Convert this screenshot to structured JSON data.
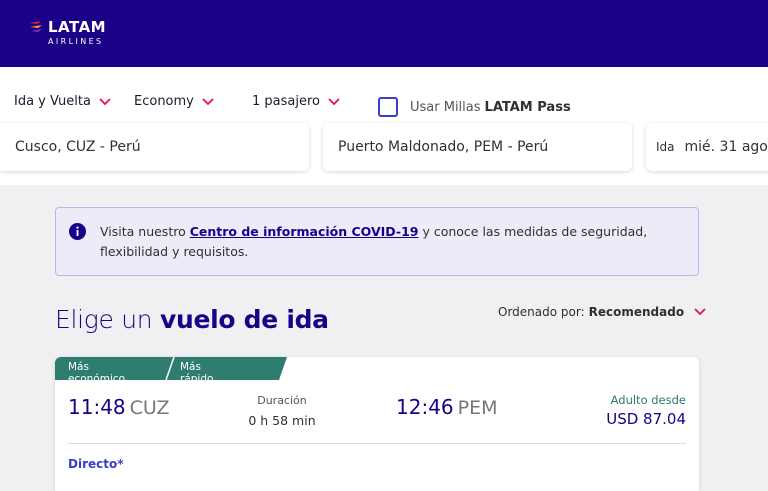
{
  "brand": {
    "name": "LATAM",
    "sub": "AIRLINES",
    "color": "#1b0088"
  },
  "search": {
    "trip_type": "Ida y Vuelta",
    "cabin": "Economy",
    "passengers": "1 pasajero",
    "millas_prefix": "Usar Millas",
    "millas_brand": "LATAM Pass",
    "millas_checked": false,
    "origin": "Cusco, CUZ - Perú",
    "destination": "Puerto Maldonado, PEM - Perú",
    "date_label": "Ida",
    "date_value": "mié. 31 ago."
  },
  "covid": {
    "prefix": "Visita nuestro ",
    "link": "Centro de información COVID-19",
    "suffix": " y conoce las medidas de seguridad, flexibilidad y requisitos."
  },
  "results": {
    "title_prefix": "Elige un ",
    "title_bold": "vuelo de ida",
    "sort_label": "Ordenado por:",
    "sort_value": "Recomendado"
  },
  "flight": {
    "badges": [
      "Más económico",
      "Más rápido"
    ],
    "depart_time": "11:48",
    "depart_code": "CUZ",
    "duration_label": "Duración",
    "duration_value": "0 h 58 min",
    "arrive_time": "12:46",
    "arrive_code": "PEM",
    "price_label": "Adulto desde",
    "price_value": "USD 87.04",
    "stops": "Directo*"
  },
  "colors": {
    "accent": "#e8114b",
    "badge": "#2e7d6e",
    "link": "#3c3cc8"
  },
  "icons": [
    "latam-logo-icon",
    "chevron-down-icon",
    "info-icon"
  ]
}
